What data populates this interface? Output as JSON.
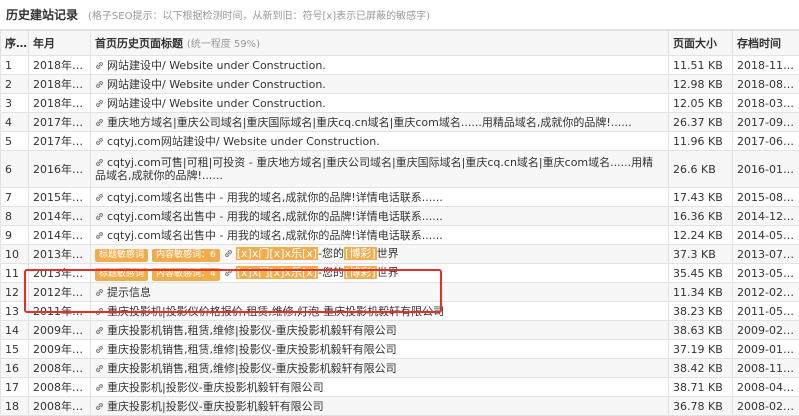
{
  "header": {
    "title": "历史建站记录",
    "hint": "(格子SEO提示：以下根据检测时间，从新到旧：符号[x]表示已屏蔽的敏感字)"
  },
  "columns": {
    "no": "序号",
    "month": "年月",
    "title": "首页历史页面标题",
    "title_sub": "(统一程度 59%)",
    "size": "页面大小",
    "archive": "存档时间"
  },
  "badges": {
    "title_sensitive": "标题敏感词",
    "content_sensitive_6": "内容敏感词：6",
    "content_sensitive_4": "内容敏感词：4"
  },
  "rows": [
    {
      "no": "1",
      "month": "2018年11月",
      "title": "网站建设中/ Website under Construction.",
      "size": "11.51 KB",
      "date": "2018-11-15"
    },
    {
      "no": "2",
      "month": "2018年08月",
      "title": "网站建设中/ Website under Construction.",
      "size": "12.98 KB",
      "date": "2018-08-04"
    },
    {
      "no": "3",
      "month": "2018年03月",
      "title": "网站建设中/ Website under Construction.",
      "size": "12.05 KB",
      "date": "2018-03-20"
    },
    {
      "no": "4",
      "month": "2017年09月",
      "title": "重庆地方域名|重庆公司域名|重庆国际域名|重庆cq.cn域名|重庆com域名......用精品域名,成就你的品牌!......",
      "size": "26.37 KB",
      "date": "2017-09-22"
    },
    {
      "no": "5",
      "month": "2017年06月",
      "title": "cqtyj.com网站建设中/ Website under Construction.",
      "size": "11.96 KB",
      "date": "2017-06-13"
    },
    {
      "no": "6",
      "month": "2016年01月",
      "title": "cqtyj.com可售|可租|可投资 - 重庆地方域名|重庆公司域名|重庆国际域名|重庆cq.cn域名|重庆com域名......用精品域名,成就你的品牌!......",
      "size": "26.6 KB",
      "date": "2016-01-10"
    },
    {
      "no": "7",
      "month": "2015年08月",
      "title": "cqtyj.com域名出售中 - 用我的域名,成就你的品牌!详情电话联系......",
      "size": "17.43 KB",
      "date": "2015-08-01"
    },
    {
      "no": "8",
      "month": "2014年12月",
      "title": "cqtyj.com域名出售中 - 用我的域名,成就你的品牌!详情电话联系......",
      "size": "16.36 KB",
      "date": "2014-12-16"
    },
    {
      "no": "9",
      "month": "2014年05月",
      "title": "cqtyj.com域名出售中 - 用我的域名,成就你的品牌!详情电话联系......",
      "size": "12.24 KB",
      "date": "2014-05-17"
    },
    {
      "no": "10",
      "month": "2013年07月",
      "t1": "[x]x门[x]x乐[x]",
      "t2": "-您的",
      "t3": "[博彩]",
      "t4": "世界",
      "size": "37.3 KB",
      "date": "2013-07-24"
    },
    {
      "no": "11",
      "month": "2013年05月",
      "t1": "[x]x门[x]x乐[x]",
      "t2": "-您的",
      "t3": "[博彩]",
      "t4": "世界",
      "size": "35.45 KB",
      "date": "2013-05-30"
    },
    {
      "no": "12",
      "month": "2012年02月",
      "title": "提示信息",
      "size": "11.34 KB",
      "date": "2012-02-13"
    },
    {
      "no": "13",
      "month": "2011年05月",
      "title": "重庆投影机|投影仪价格报价,租赁,维修,灯泡-重庆投影机毅轩有限公司",
      "size": "38.23 KB",
      "date": "2011-05-03"
    },
    {
      "no": "14",
      "month": "2009年02月",
      "title": "重庆投影机销售,租赁,维修|投影仪-重庆投影机毅轩有限公司",
      "size": "38.63 KB",
      "date": "2009-02-27"
    },
    {
      "no": "15",
      "month": "2009年01月",
      "title": "重庆投影机销售,租赁,维修|投影仪-重庆投影机毅轩有限公司",
      "size": "37.19 KB",
      "date": "2009-01-24"
    },
    {
      "no": "16",
      "month": "2008年11月",
      "title": "重庆投影机销售,租赁,维修|投影仪-重庆投影机毅轩有限公司",
      "size": "38.42 KB",
      "date": "2008-11-03"
    },
    {
      "no": "17",
      "month": "2008年04月",
      "title": "重庆投影机|投影仪-重庆投影机毅轩有限公司",
      "size": "38.71 KB",
      "date": "2008-04-10"
    },
    {
      "no": "18",
      "month": "2008年02月",
      "title": "重庆投影机|投影仪-重庆投影机毅轩有限公司",
      "size": "36.78 KB",
      "date": "2008-02-20"
    }
  ],
  "colors": {
    "accent": "#f0ad4e",
    "highlight_box": "#e0302a",
    "header_bg": "#f7f7f7"
  }
}
